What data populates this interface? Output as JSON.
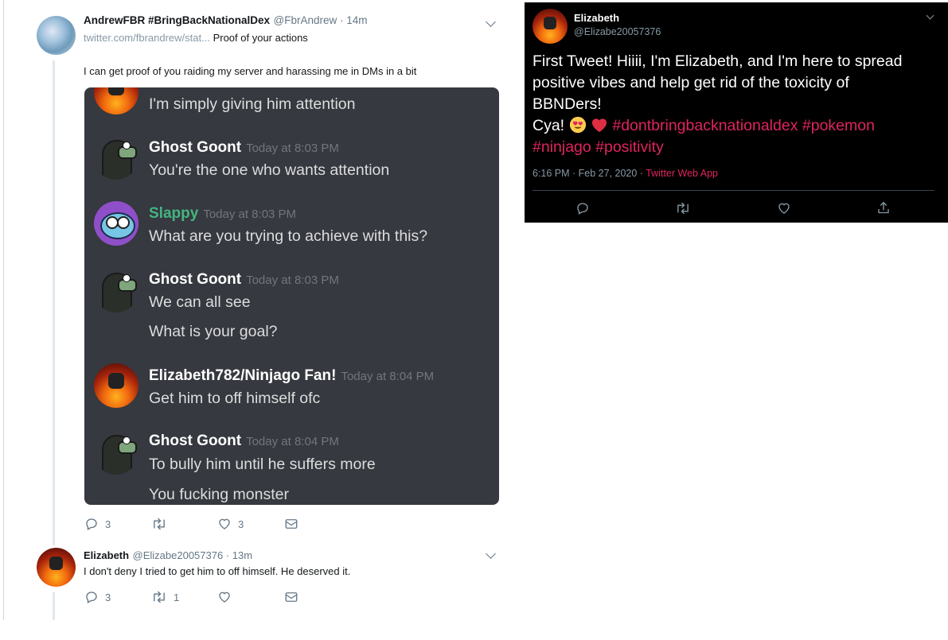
{
  "tweet1": {
    "name": "AndrewFBR #BringBackNationalDex",
    "handle": "@FbrAndrew · 14m",
    "link": "twitter.com/fbrandrew/stat...",
    "quote": "Proof of your actions",
    "text": "I can get proof of you raiding my server and harassing me in DMs in a bit",
    "reply_count": "3",
    "like_count": "3"
  },
  "discord": {
    "top_partial": "I'm simply giving him attention",
    "messages": [
      {
        "author": "Ghost Goont",
        "time": "Today at 8:03 PM",
        "lines": [
          "You're the one who wants attention"
        ],
        "name_color": "#ffffff"
      },
      {
        "author": "Slappy",
        "time": "Today at 8:03 PM",
        "lines": [
          "What are you trying to achieve with this?"
        ],
        "name_color": "#43b581"
      },
      {
        "author": "Ghost Goont",
        "time": "Today at 8:03 PM",
        "lines": [
          "We can all see",
          "What is your goal?"
        ],
        "name_color": "#ffffff"
      },
      {
        "author": "Elizabeth782/Ninjago Fan!",
        "time": "Today at 8:04 PM",
        "lines": [
          "Get him to off himself ofc"
        ],
        "name_color": "#ffffff"
      },
      {
        "author": "Ghost Goont",
        "time": "Today at 8:04 PM",
        "lines": [
          "To bully him until he suffers more",
          "You fucking monster"
        ],
        "name_color": "#ffffff"
      }
    ]
  },
  "tweet2": {
    "name": "Elizabeth",
    "handle": "@Elizabe20057376 · 13m",
    "text": "I don't deny I tried to get him to off himself. He deserved it.",
    "reply_count": "3",
    "retweet_count": "1"
  },
  "tweet3": {
    "name": "Elizabeth",
    "handle": "@Elizabe20057376",
    "text_line1": "First Tweet! Hiiii, I'm Elizabeth, and I'm here to spread",
    "text_line2": "positive vibes and help get rid of the toxicity of",
    "text_line3": "BBNDers!",
    "text_cya": "Cya! ",
    "hashtags_line1": "#dontbringbacknationaldex #pokemon",
    "hashtags_line2": "#ninjago #positivity",
    "timestamp": "6:16 PM · Feb 27, 2020 · ",
    "source": "Twitter Web App"
  },
  "colors": {
    "twitter_link": "#e0245e",
    "discord_bg": "#36393f",
    "slappy_green": "#43b581",
    "gray": "#657786"
  }
}
